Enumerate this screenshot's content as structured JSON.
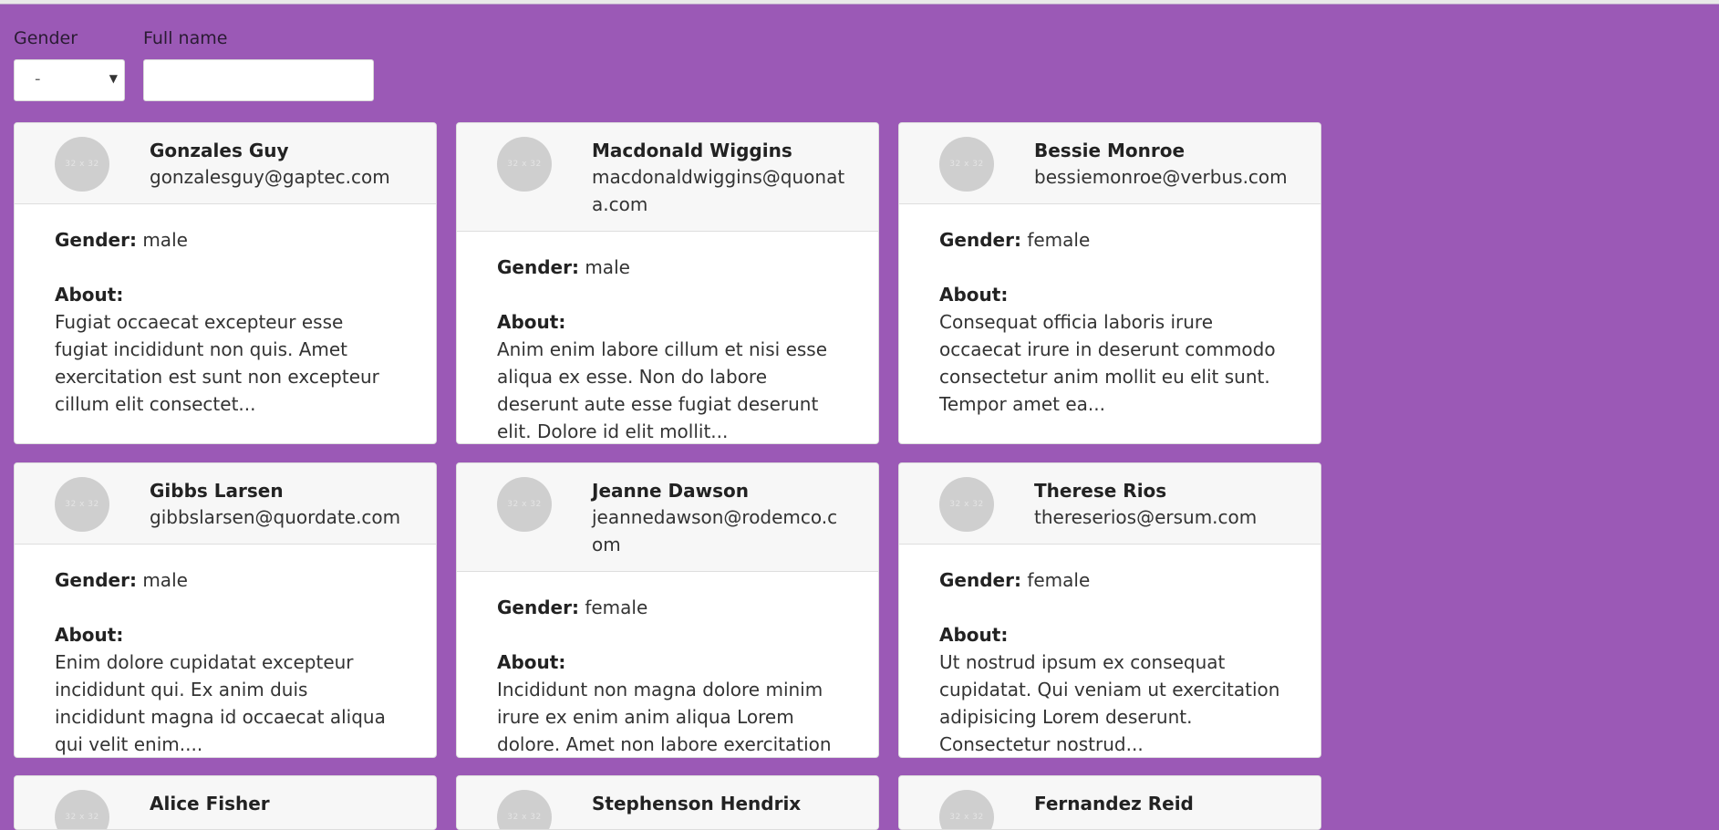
{
  "filters": {
    "gender_label": "Gender",
    "gender_value": "-",
    "fullname_label": "Full name",
    "fullname_value": ""
  },
  "labels": {
    "gender": "Gender:",
    "about": "About:",
    "avatar_placeholder": "32 x 32"
  },
  "users": [
    {
      "name": "Gonzales Guy",
      "email": "gonzalesguy@gaptec.com",
      "gender": "male",
      "about": "Fugiat occaecat excepteur esse fugiat incididunt non quis. Amet exercitation est sunt non excepteur cillum elit consectet..."
    },
    {
      "name": "Macdonald Wiggins",
      "email": "macdonaldwiggins@quonata.com",
      "gender": "male",
      "about": "Anim enim labore cillum et nisi esse aliqua ex esse. Non do labore deserunt aute esse fugiat deserunt elit. Dolore id elit mollit..."
    },
    {
      "name": "Bessie Monroe",
      "email": "bessiemonroe@verbus.com",
      "gender": "female",
      "about": "Consequat officia laboris irure occaecat irure in deserunt commodo consectetur anim mollit eu elit sunt. Tempor amet ea..."
    },
    {
      "name": "Gibbs Larsen",
      "email": "gibbslarsen@quordate.com",
      "gender": "male",
      "about": "Enim dolore cupidatat excepteur incididunt qui. Ex anim duis incididunt magna id occaecat aliqua qui velit enim...."
    },
    {
      "name": "Jeanne Dawson",
      "email": "jeannedawson@rodemco.com",
      "gender": "female",
      "about": "Incididunt non magna dolore minim irure ex enim anim aliqua Lorem dolore. Amet non labore exercitation deserunt officia..."
    },
    {
      "name": "Therese Rios",
      "email": "thereserios@ersum.com",
      "gender": "female",
      "about": "Ut nostrud ipsum ex consequat cupidatat. Qui veniam ut exercitation adipisicing Lorem deserunt. Consectetur nostrud..."
    },
    {
      "name": "Alice Fisher",
      "email": "",
      "gender": "",
      "about": ""
    },
    {
      "name": "Stephenson Hendrix",
      "email": "",
      "gender": "",
      "about": ""
    },
    {
      "name": "Fernandez Reid",
      "email": "",
      "gender": "",
      "about": ""
    }
  ]
}
